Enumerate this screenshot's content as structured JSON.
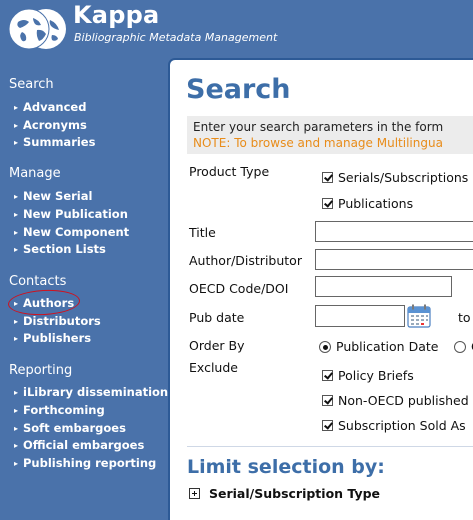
{
  "header": {
    "title": "Kappa",
    "subtitle": "Bibliographic Metadata Management",
    "logo_icon": "oecd-globe-logo"
  },
  "sidebar": {
    "sections": [
      {
        "title": "Search",
        "items": [
          "Advanced",
          "Acronyms",
          "Summaries"
        ]
      },
      {
        "title": "Manage",
        "items": [
          "New Serial",
          "New Publication",
          "New Component",
          "Section Lists"
        ]
      },
      {
        "title": "Contacts",
        "items": [
          "Authors",
          "Distributors",
          "Publishers"
        ]
      },
      {
        "title": "Reporting",
        "items": [
          "iLibrary dissemination",
          "Forthcoming",
          "Soft embargoes",
          "Official embargoes",
          "Publishing reporting"
        ]
      }
    ],
    "highlight_color": "#d0111d"
  },
  "main": {
    "title": "Search",
    "note_line1": "Enter your search parameters in the form",
    "note_line2": "NOTE: To browse and manage Multilingua",
    "note_color": "#e88c1a",
    "form": {
      "product_type_label": "Product Type",
      "product_type_options": [
        "Serials/Subscriptions",
        "Publications"
      ],
      "title_label": "Title",
      "author_label": "Author/Distributor",
      "oecd_code_label": "OECD Code/DOI",
      "pub_date_label": "Pub date",
      "to_label": "to",
      "order_by_label": "Order By",
      "order_by_options": [
        "Publication Date",
        "C"
      ],
      "exclude_label": "Exclude",
      "exclude_options": [
        "Policy Briefs",
        "Non-OECD published",
        "Subscription Sold As"
      ]
    },
    "limit_title": "Limit selection by:",
    "serial_type_label": "Serial/Subscription Type"
  }
}
